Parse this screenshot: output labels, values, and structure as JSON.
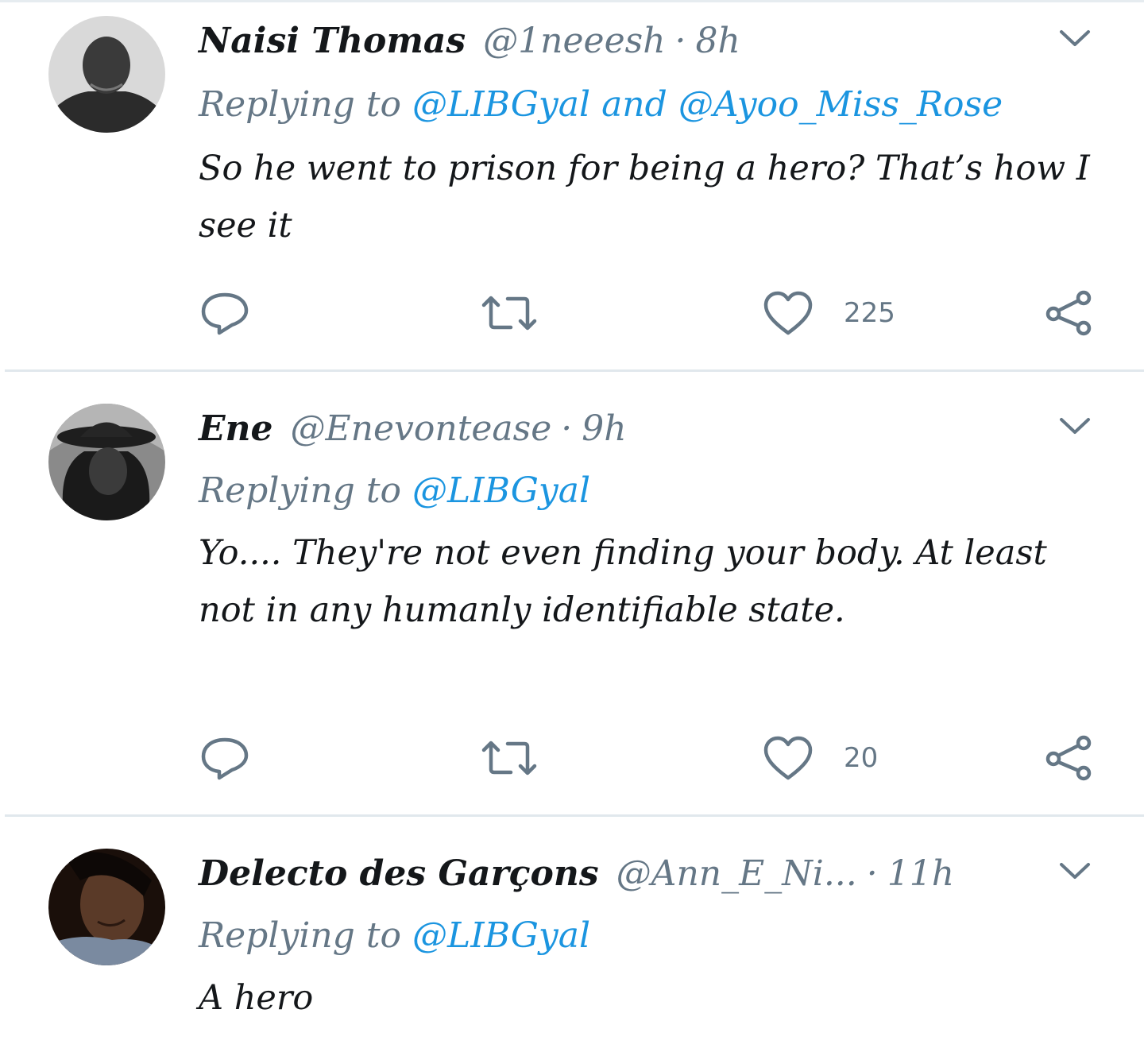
{
  "colors": {
    "name": "#14171a",
    "secondary": "#657786",
    "mention": "#1b95e0",
    "divider": "#e1e8ed"
  },
  "icons": {
    "reply": "reply-icon",
    "retweet": "retweet-icon",
    "like": "heart-icon",
    "share": "share-icon",
    "menu": "chevron-down-icon"
  },
  "tweets": [
    {
      "display_name": "Naisi Thomas",
      "handle": "@1neeesh",
      "separator": "·",
      "time": "8h",
      "replying_prefix": "Replying to",
      "mention_1": "@LIBGyal",
      "conjunction": "and",
      "mention_2": "@Ayoo_Miss_Rose",
      "text": "So he went to prison for being a hero? That’s how I see it",
      "like_count": "225"
    },
    {
      "display_name": "Ene",
      "handle": "@Enevontease",
      "separator": "·",
      "time": "9h",
      "replying_prefix": "Replying to",
      "mention_1": "@LIBGyal",
      "text": "Yo.... They're not even finding your body. At least not in any humanly identifiable state.",
      "like_count": "20"
    },
    {
      "display_name": "Delecto des Garçons",
      "handle": "@Ann_E_Ni...",
      "separator": "·",
      "time": "11h",
      "replying_prefix": "Replying to",
      "mention_1": "@LIBGyal",
      "text": "A hero"
    }
  ]
}
